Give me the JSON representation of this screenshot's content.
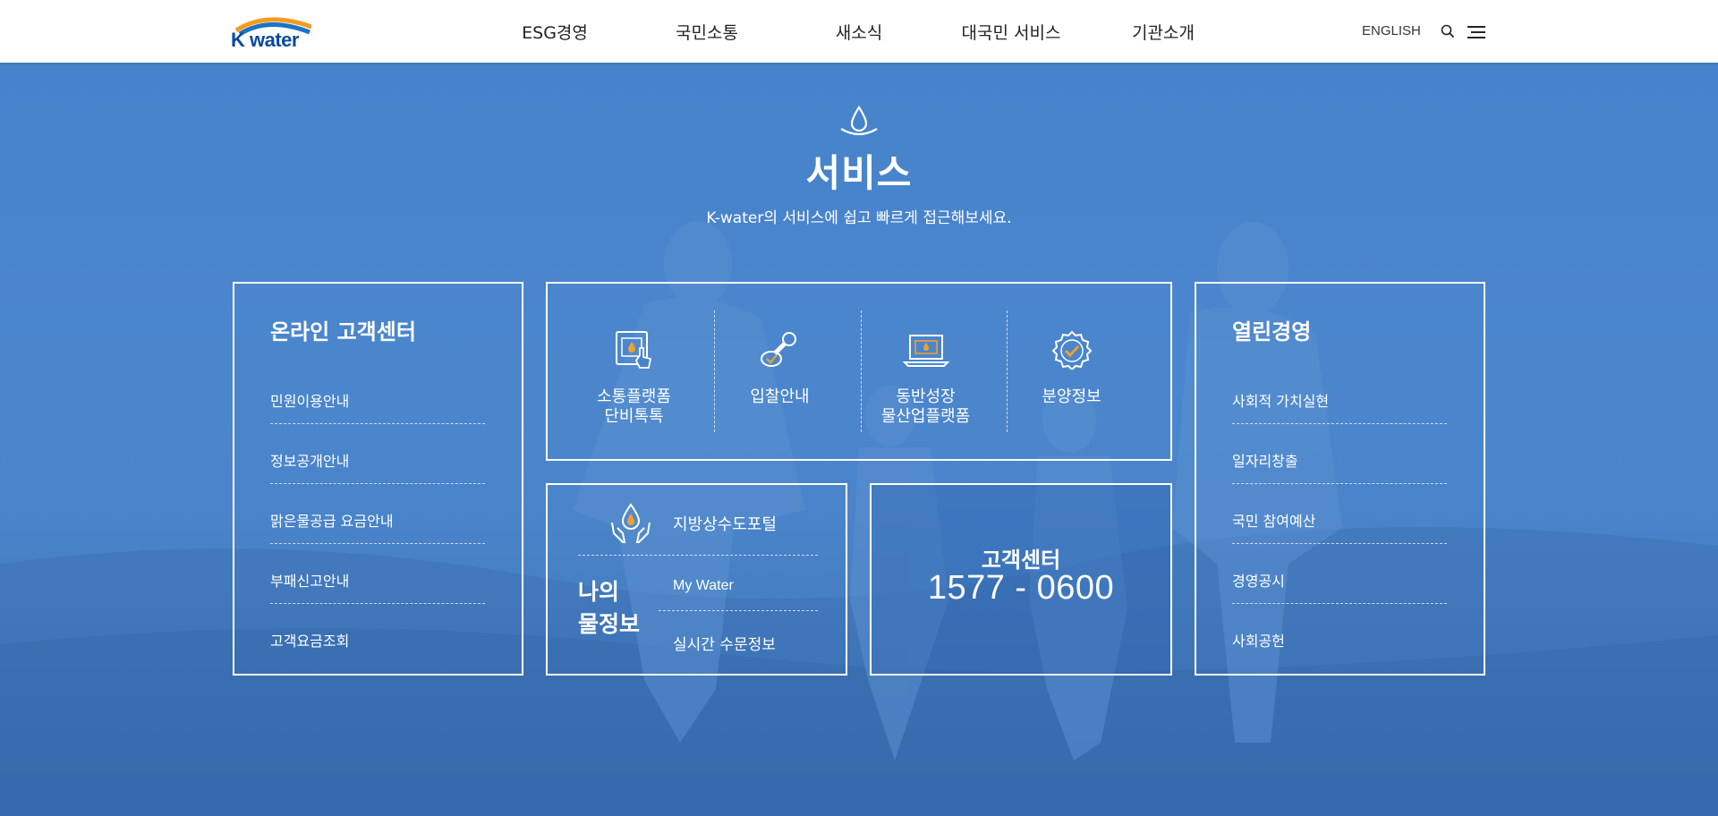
{
  "header": {
    "logo_text": "K water",
    "nav": [
      "ESG경영",
      "국민소통",
      "새소식",
      "대국민 서비스",
      "기관소개"
    ],
    "lang_label": "ENGLISH",
    "search_icon": "search-icon",
    "menu_icon": "hamburger-menu-icon"
  },
  "hero": {
    "title": "서비스",
    "subtitle": "K-water의 서비스에 쉽고 빠르게 접근해보세요.",
    "icon": "water-drop-icon"
  },
  "online_center": {
    "title": "온라인 고객센터",
    "links": [
      "민원이용안내",
      "정보공개안내",
      "맑은물공급 요금안내",
      "부패신고안내",
      "고객요금조회"
    ]
  },
  "services": [
    {
      "line1": "소통플랫폼",
      "line2": "단비톡톡",
      "icon": "tablet-touch-icon"
    },
    {
      "line1": "입찰안내",
      "line2": "",
      "icon": "stamp-icon"
    },
    {
      "line1": "동반성장",
      "line2": "물산업플랫폼",
      "icon": "laptop-icon"
    },
    {
      "line1": "분양정보",
      "line2": "",
      "icon": "badge-check-icon"
    }
  ],
  "my_water": {
    "title_line1": "나의",
    "title_line2": "물정보",
    "links": [
      "지방상수도포털",
      "My Water",
      "실시간 수문정보"
    ],
    "icon": "hands-drop-icon"
  },
  "customer_center": {
    "title": "고객센터",
    "phone": "1577 - 0600"
  },
  "open_management": {
    "title": "열린경영",
    "links": [
      "사회적 가치실현",
      "일자리창출",
      "국민 참여예산",
      "경영공시",
      "사회공헌"
    ]
  },
  "colors": {
    "background": "#4683cc",
    "logo_blue": "#0a4a9e",
    "accent_orange": "#f0a030"
  }
}
